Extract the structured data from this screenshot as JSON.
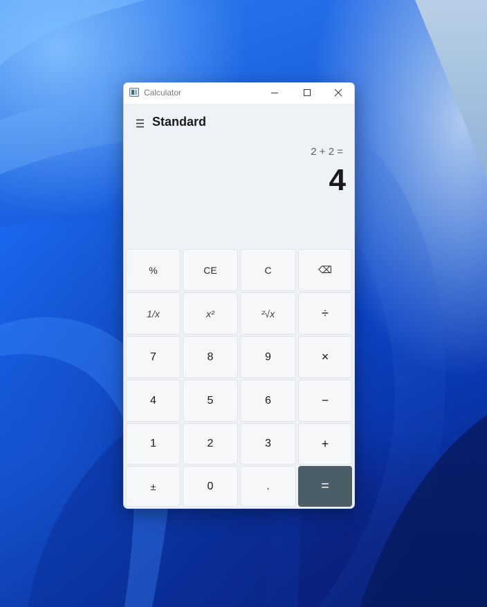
{
  "window": {
    "title": "Calculator"
  },
  "header": {
    "mode": "Standard"
  },
  "display": {
    "expression": "2 + 2 =",
    "result": "4"
  },
  "keys": [
    {
      "label": "%",
      "name": "percent-button",
      "style": "fn"
    },
    {
      "label": "CE",
      "name": "clear-entry-button",
      "style": "fn"
    },
    {
      "label": "C",
      "name": "clear-button",
      "style": "fn"
    },
    {
      "label": "⌫",
      "name": "backspace-button",
      "style": "fn"
    },
    {
      "label": "1/x",
      "name": "reciprocal-button",
      "style": "italic"
    },
    {
      "label": "x²",
      "name": "square-button",
      "style": "italic"
    },
    {
      "label": "²√x",
      "name": "square-root-button",
      "style": "italic"
    },
    {
      "label": "÷",
      "name": "divide-button",
      "style": "op"
    },
    {
      "label": "7",
      "name": "digit-7-button",
      "style": "num"
    },
    {
      "label": "8",
      "name": "digit-8-button",
      "style": "num"
    },
    {
      "label": "9",
      "name": "digit-9-button",
      "style": "num"
    },
    {
      "label": "×",
      "name": "multiply-button",
      "style": "op"
    },
    {
      "label": "4",
      "name": "digit-4-button",
      "style": "num"
    },
    {
      "label": "5",
      "name": "digit-5-button",
      "style": "num"
    },
    {
      "label": "6",
      "name": "digit-6-button",
      "style": "num"
    },
    {
      "label": "−",
      "name": "subtract-button",
      "style": "op"
    },
    {
      "label": "1",
      "name": "digit-1-button",
      "style": "num"
    },
    {
      "label": "2",
      "name": "digit-2-button",
      "style": "num"
    },
    {
      "label": "3",
      "name": "digit-3-button",
      "style": "num"
    },
    {
      "label": "+",
      "name": "add-button",
      "style": "op"
    },
    {
      "label": "±",
      "name": "negate-button",
      "style": "fn"
    },
    {
      "label": "0",
      "name": "digit-0-button",
      "style": "num"
    },
    {
      "label": ".",
      "name": "decimal-button",
      "style": "num"
    },
    {
      "label": "=",
      "name": "equals-button",
      "style": "equals"
    }
  ],
  "colors": {
    "equals_key": "#4b5d66",
    "window_background": "#eef2f6",
    "key_background": "#f6f7f8"
  },
  "icons": {
    "app": "calculator-app-icon",
    "menu": "hamburger-menu-icon",
    "minimize": "minimize-icon",
    "maximize": "maximize-icon",
    "close": "close-icon"
  }
}
